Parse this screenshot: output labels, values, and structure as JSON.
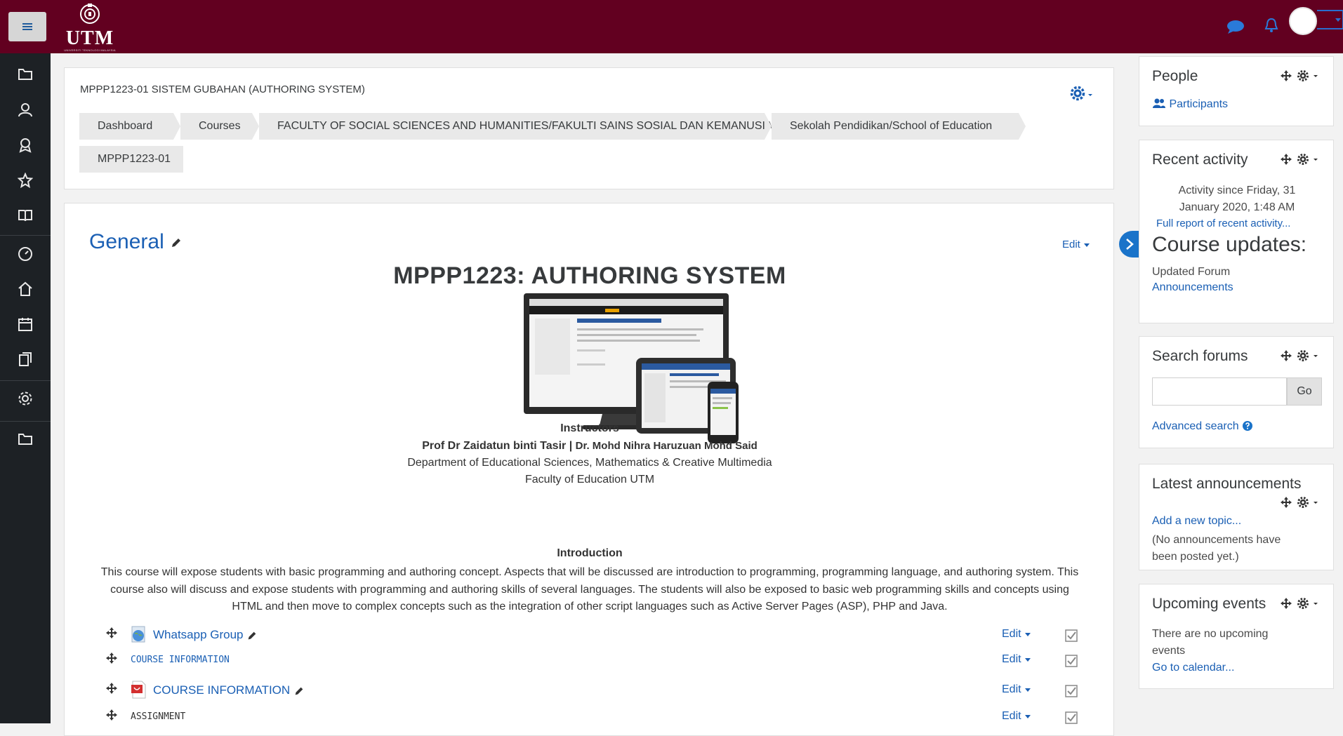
{
  "navbar": {
    "logo_text": "UTM",
    "logo_subtext": "UNIVERSITI TEKNOLOGI MALAYSIA",
    "icons": [
      "menu-icon",
      "messages-icon",
      "notifications-icon",
      "user-avatar"
    ]
  },
  "drawer": {
    "icons": [
      "folder-icon",
      "participants-icon",
      "badges-icon",
      "star-icon",
      "book-icon",
      "dashboard-icon",
      "home-icon",
      "calendar-icon",
      "files-icon",
      "settings-icon",
      "folder-icon"
    ]
  },
  "course_header": {
    "title": "MPPP1223-01 SISTEM GUBAHAN (AUTHORING SYSTEM)",
    "breadcrumbs": [
      "Dashboard",
      "Courses",
      "FACULTY OF SOCIAL SCIENCES AND HUMANITIES/FAKULTI SAINS SOSIAL DAN KEMANUSIAAN",
      "Sekolah Pendidikan/School of Education",
      "MPPP1223-01"
    ]
  },
  "section": {
    "title": "General",
    "edit_label": "Edit",
    "heading": "MPPP1223: AUTHORING SYSTEM",
    "instructors_label": "Instructors",
    "instructor_1": "Prof Dr Zaidatun binti Tasir",
    "separator": "|",
    "instructor_2": "Dr. Mohd Nihra Haruzuan Mohd Said",
    "department": "Department of Educational Sciences, Mathematics & Creative Multimedia",
    "faculty": "Faculty of Education UTM",
    "introduction_label": "Introduction",
    "introduction_text": "This course will expose students with basic programming and authoring concept. Aspects that will be discussed are introduction to programming, programming language, and authoring system. This course also will discuss and expose students with programming and authoring skills of several languages. The students will also be exposed to basic web programming skills and concepts using HTML and then move to complex concepts such as the integration of other script languages such as Active Server Pages (ASP), PHP and Java.",
    "activities": [
      {
        "name": "Whatsapp Group",
        "type": "url",
        "edit": "Edit"
      },
      {
        "name": "COURSE INFORMATION",
        "type": "label",
        "edit": "Edit"
      },
      {
        "name": "COURSE INFORMATION",
        "type": "pdf",
        "edit": "Edit"
      },
      {
        "name": "ASSIGNMENT",
        "type": "label-dark",
        "edit": "Edit"
      }
    ]
  },
  "blocks": {
    "people": {
      "title": "People",
      "link": "Participants"
    },
    "recent_activity": {
      "title": "Recent activity",
      "since_line1": "Activity since Friday, 31",
      "since_line2": "January 2020, 1:48 AM",
      "full_report": "Full report of recent activity...",
      "updates_title": "Course updates:",
      "updated_forum": "Updated Forum",
      "announcements": "Announcements"
    },
    "search_forums": {
      "title": "Search forums",
      "go_label": "Go",
      "advanced": "Advanced search"
    },
    "latest_announcements": {
      "title": "Latest announcements",
      "add_topic": "Add a new topic...",
      "none_line1": "(No announcements have",
      "none_line2": "been posted yet.)"
    },
    "upcoming_events": {
      "title": "Upcoming events",
      "none_line1": "There are no upcoming",
      "none_line2": "events",
      "calendar_link": "Go to calendar..."
    }
  },
  "colors": {
    "navbar": "#620020",
    "drawer": "#1d2125",
    "link": "#1a5fb4",
    "accent": "#1a73c9"
  }
}
